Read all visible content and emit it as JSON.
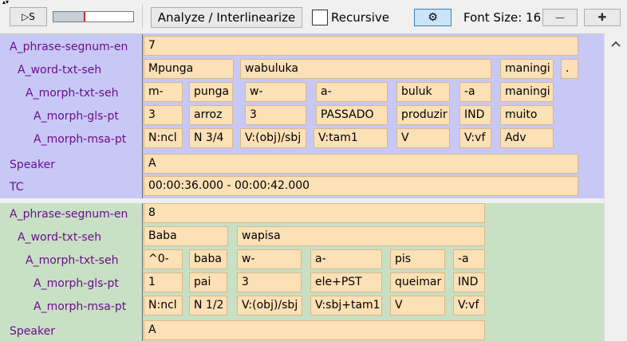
{
  "toolbar": {
    "play_label": "▷S",
    "analyze_label": "Analyze / Interlinearize",
    "recursive_label": "Recursive",
    "font_size_label": "Font Size: 16",
    "decrease_label": "—",
    "increase_label": "✚",
    "settings_icon": "⚙",
    "colors": {
      "slider_marker": "#cc2b2b",
      "active_button": "#cce4f7"
    }
  },
  "blocks": [
    {
      "color": "#c8c8f6",
      "tiers": {
        "phrase": "A_phrase-segnum-en",
        "word": "A_word-txt-seh",
        "morph": "A_morph-txt-seh",
        "gloss": "A_morph-gls-pt",
        "msa": "A_morph-msa-pt",
        "speaker": "Speaker",
        "tc": "TC"
      },
      "phrase_value": "7",
      "words": [
        "Mpunga",
        "wabuluka",
        "maningi",
        "."
      ],
      "morphs": [
        "m-",
        "punga",
        "w-",
        "a-",
        "buluk",
        "-a",
        "maningi"
      ],
      "glosses": [
        "3",
        "arroz",
        "3",
        "PASSADO",
        "produzir",
        "IND",
        "muito"
      ],
      "msas": [
        "N:ncl",
        "N 3/4",
        "V:(obj)/sbj",
        "V:tam1",
        "V",
        "V:vf",
        "Adv"
      ],
      "speaker_value": "A",
      "tc_value": "00:00:36.000 - 00:00:42.000"
    },
    {
      "color": "#c8e0c4",
      "tiers": {
        "phrase": "A_phrase-segnum-en",
        "word": "A_word-txt-seh",
        "morph": "A_morph-txt-seh",
        "gloss": "A_morph-gls-pt",
        "msa": "A_morph-msa-pt",
        "speaker": "Speaker"
      },
      "phrase_value": "8",
      "words": [
        "Baba",
        "wapisa"
      ],
      "morphs": [
        "^0-",
        "baba",
        "w-",
        "a-",
        "pis",
        "-a"
      ],
      "glosses": [
        "1",
        "pai",
        "3",
        "ele+PST",
        "queimar",
        "IND"
      ],
      "msas": [
        "N:ncl",
        "N 1/2",
        "V:(obj)/sbj",
        "V:sbj+tam1",
        "V",
        "V:vf"
      ],
      "speaker_value": "A"
    }
  ]
}
